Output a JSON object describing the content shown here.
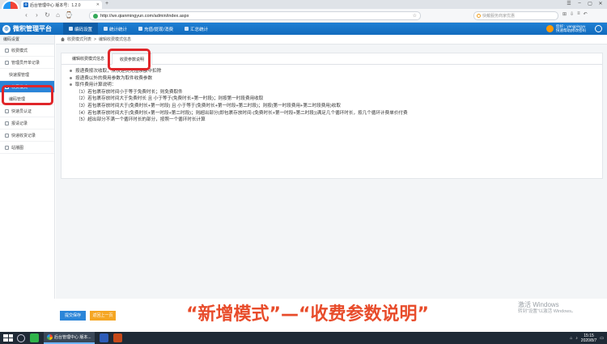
{
  "browser": {
    "tab_title": "后台管理中心 版本号：1.2.0",
    "url": "http://wx.qianmingyun.com/admin/index.aspx",
    "search_placeholder": "快戴服务商家优惠",
    "nav": {
      "back": "‹",
      "forward": "›",
      "refresh": "↻",
      "home": "⌂",
      "history": "⌚",
      "new_tab": "+"
    },
    "window_controls": [
      "☰",
      "–",
      "▢",
      "✕"
    ]
  },
  "app": {
    "logo_text": "微积管理平台",
    "top_nav": [
      {
        "label": "编码设置"
      },
      {
        "label": "统计统计"
      },
      {
        "label": "充值/提现/消费"
      },
      {
        "label": "汇总统计"
      }
    ],
    "user": {
      "line1": "您好：yangpingyu",
      "line2": "快速帮助|修改密码"
    }
  },
  "sidebar": {
    "header": "编码设置",
    "items": [
      {
        "label": "收费模式"
      },
      {
        "label": "管理员开单记录"
      },
      {
        "label": "快速报管理"
      },
      {
        "label": "收费模式"
      },
      {
        "label": "编码管理"
      },
      {
        "label": "快速员认证"
      },
      {
        "label": "报请记录"
      },
      {
        "label": "快递收货记录"
      },
      {
        "label": "站播图"
      }
    ]
  },
  "breadcrumb": {
    "root": "收费模式列表",
    "sep": ">",
    "current": "编辑收费模式信息"
  },
  "tabs": [
    {
      "label": "编辑收费模式信息"
    },
    {
      "label": "收费参数说明"
    }
  ],
  "content": {
    "lines": [
      "按递费按次收取，从快递员充值余额中扣除",
      "按递费以外的费用参数为取件收费参数",
      "取件费用计算说明："
    ],
    "rules": [
      "（1）若包裹存放时间小于等于免费时长；则免费取件",
      "（2）若包裹存放时间大于免费时长 且 小于等于(免费时长+第一时段)；则按第一时段费用收取",
      "（3）若包裹存放时间大于(免费时长+第一时段) 且 小于等于(免费时长+第一时段+第二时段)；则按(第一时段费用+第二时段费用)收取",
      "（4）若包裹存放时间大于(免费时长+第一时段+第二时段)；则超出部分(即包裹存放时间-(免费时长+第一时段+第二时段))满足几个循环时长，按几个循环计费单价付费",
      "（5）超出部分不满一个循环时长的部分，按照一个循环时长计算"
    ]
  },
  "buttons": {
    "save": "提交保存",
    "prev": "返回上一页"
  },
  "subtitle": "“新增模式”—“收费参数说明”",
  "watermark": {
    "line1": "激活 Windows",
    "line2": "转到“设置”以激活 Windows。"
  },
  "taskbar": {
    "browser_label": "后台管理中心 版本...",
    "time": "15:15",
    "date": "2020/8/7"
  },
  "colors": {
    "header": "#1a76cb",
    "highlight": "#e0262a",
    "subtitle": "#e84c2b",
    "save": "#2b85d8",
    "prev": "#f5a623"
  }
}
